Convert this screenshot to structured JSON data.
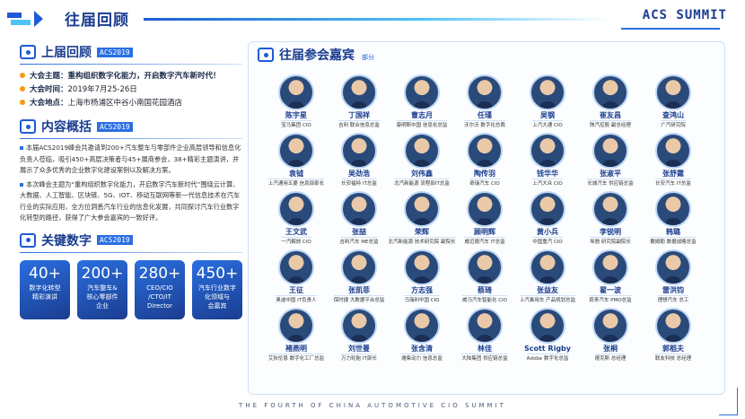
{
  "header": {
    "title": "往届回顾",
    "brand": "ACS SUMMIT"
  },
  "left": {
    "review": {
      "title": "上届回顾",
      "tag": "ACS2019",
      "items": [
        {
          "label": "大会主题：",
          "value": "重构组织数字化能力，开启数字汽车新时代！"
        },
        {
          "label": "大会时间：",
          "value": "2019年7月25-26日"
        },
        {
          "label": "大会地点：",
          "value": "上海市杨浦区中谷小南国花园酒店"
        }
      ]
    },
    "overview": {
      "title": "内容概括",
      "tag": "ACS2019",
      "para1": "本届ACS2019峰会共邀请到200+汽车整车与零部件企业高层领导和信息化负责人莅临，吸引450+高层决策者与45+展商参会，38+精彩主题演讲，并展示了众多优秀的企业数字化建设案例以及解决方案。",
      "para2": "本次峰会主题为“重构组织数字化能力，开启数字汽车新时代”围绕云计算、大数据、人工智能、区块链、5G、IOT、移动互联网等新一代信息技术在汽车行业的实际应用，全方位洞悉汽车行业的信息化发展，共同探讨汽车行业数字化转型的路径，获得了广大参会嘉宾的一致好评。"
    },
    "stats": {
      "title": "关键数字",
      "tag": "ACS2019",
      "items": [
        {
          "num": "40+",
          "desc": "数字化转型\n精彩演讲"
        },
        {
          "num": "200+",
          "desc": "汽车整车&\n核心零部件\n企业"
        },
        {
          "num": "280+",
          "desc": "CEO/CIO\n/CTO/IT\nDirector"
        },
        {
          "num": "450+",
          "desc": "汽车行业数字\n化领域与\n会嘉宾"
        }
      ]
    }
  },
  "right": {
    "title": "往届参会嘉宾",
    "tag": "部分",
    "guests": [
      {
        "name": "陈宇星",
        "title": "宝马集团 CIO"
      },
      {
        "name": "丁国祥",
        "title": "吉利 联合信息总监"
      },
      {
        "name": "曹志月",
        "title": "康明斯中国 信息化总监"
      },
      {
        "name": "任瑾",
        "title": "沃尔沃 数字化总裁"
      },
      {
        "name": "吴钢",
        "title": "上汽大通 CIO"
      },
      {
        "name": "崔友昌",
        "title": "陕汽控股 副总经理"
      },
      {
        "name": "查鸿山",
        "title": "广汽研究院"
      },
      {
        "name": "",
        "title": ""
      },
      {
        "name": "袁钺",
        "title": "上汽通用五菱 信息部部长"
      },
      {
        "name": "吴劲浩",
        "title": "长安福特 IT总监"
      },
      {
        "name": "刘伟鑫",
        "title": "北汽新能源 流程部IT总监"
      },
      {
        "name": "陶传羽",
        "title": "奇瑞汽车 CIO"
      },
      {
        "name": "钱华华",
        "title": "上汽大众 CIO"
      },
      {
        "name": "张淑平",
        "title": "长城汽车 供应链总监"
      },
      {
        "name": "张舒霆",
        "title": "长安汽车 IT总监"
      },
      {
        "name": "",
        "title": ""
      },
      {
        "name": "王文武",
        "title": "一汽解放 CIO"
      },
      {
        "name": "张喆",
        "title": "吉利汽车 ME总监"
      },
      {
        "name": "荣辉",
        "title": "北汽新能源 技术研究院 副院长"
      },
      {
        "name": "顾明辉",
        "title": "威迈德汽车 IT总监"
      },
      {
        "name": "黄小兵",
        "title": "中国重汽 CIO"
      },
      {
        "name": "李锐明",
        "title": "埃驰 研究院副院长"
      },
      {
        "name": "韩璐",
        "title": "戴姆勒 数据战略总监"
      },
      {
        "name": "",
        "title": ""
      },
      {
        "name": "王征",
        "title": "奥迪中国 IT负责人"
      },
      {
        "name": "张凯菲",
        "title": "保时捷 大数据平台总监"
      },
      {
        "name": "方志强",
        "title": "马瑞利中国 CIO"
      },
      {
        "name": "蔡琦",
        "title": "威马汽车智能化 CIO"
      },
      {
        "name": "张益友",
        "title": "上汽乘用车 产品规划总监"
      },
      {
        "name": "翟一波",
        "title": "蔚来汽车 PMO总监"
      },
      {
        "name": "雷洪钧",
        "title": "理想汽车 总工"
      },
      {
        "name": "",
        "title": ""
      },
      {
        "name": "褚燕明",
        "title": "艾狄伦恩 数字化工厂总监"
      },
      {
        "name": "刘世曼",
        "title": "万力轮胎 IT部长"
      },
      {
        "name": "张含清",
        "title": "潍柴动力 信息总监"
      },
      {
        "name": "林佳",
        "title": "大陆集团 供应链总监"
      },
      {
        "name": "Scott Rigby",
        "title": "Adobe 数字化总监"
      },
      {
        "name": "张桐",
        "title": "德克斯 总经理"
      },
      {
        "name": "郭稻夫",
        "title": "联友科技 总经理"
      },
      {
        "name": "",
        "title": ""
      }
    ]
  },
  "footer": "THE FOURTH OF CHINA AUTOMOTIVE CIO SUMMIT"
}
